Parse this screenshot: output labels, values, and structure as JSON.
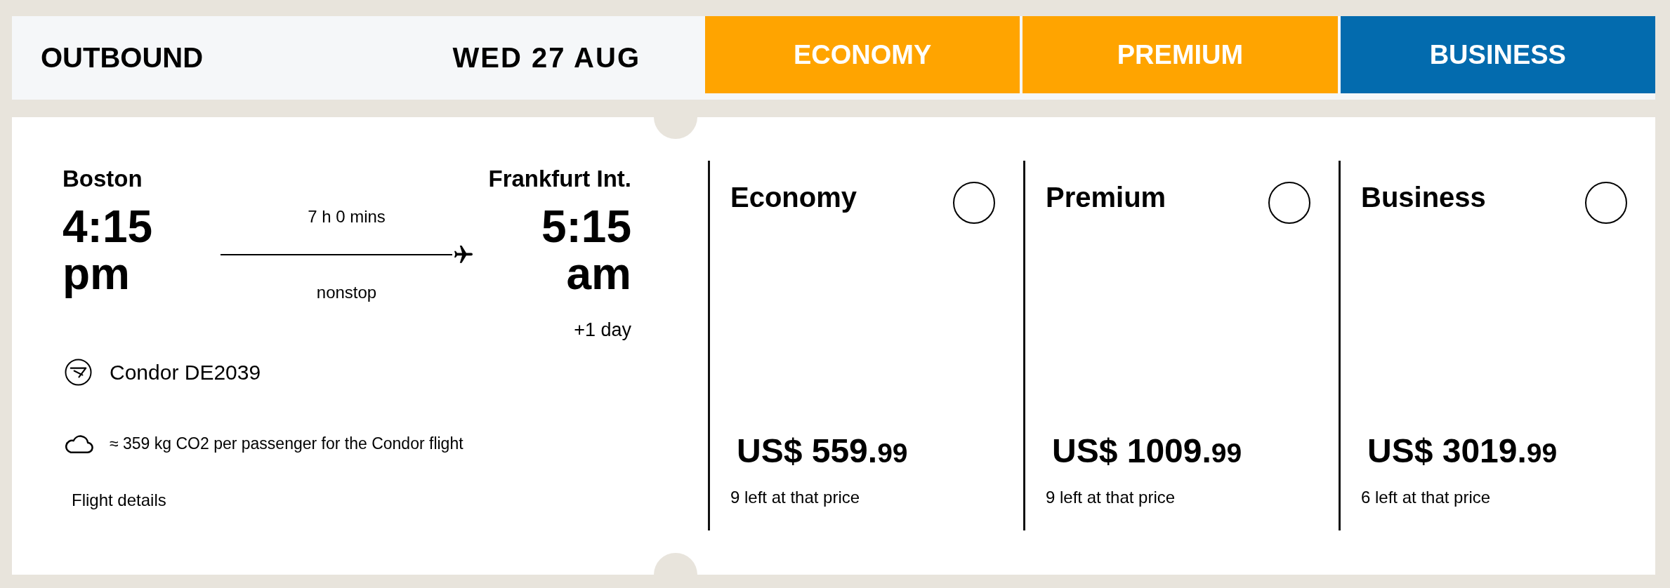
{
  "header": {
    "direction": "OUTBOUND",
    "date": "WED 27 AUG"
  },
  "cabins": [
    {
      "label": "ECONOMY",
      "color": "#ffa400"
    },
    {
      "label": "PREMIUM",
      "color": "#ffa400"
    },
    {
      "label": "BUSINESS",
      "color": "#036bae"
    }
  ],
  "flight": {
    "origin": {
      "city": "Boston",
      "time": "4:15 pm"
    },
    "destination": {
      "city": "Frankfurt Int.",
      "time": "5:15 am",
      "day_offset": "+1 day"
    },
    "duration": "7 h 0 mins",
    "stops": "nonstop",
    "carrier": "Condor DE2039",
    "emissions": "≈ 359 kg CO2 per passenger for the Condor flight",
    "details_link": "Flight details"
  },
  "fares": [
    {
      "name": "Economy",
      "selected": false,
      "price": "US$ 559.99",
      "availability": "9 left at that price"
    },
    {
      "name": "Premium",
      "selected": false,
      "price": "US$ 1009.99",
      "availability": "9 left at that price"
    },
    {
      "name": "Business",
      "selected": false,
      "price": "US$ 3019.99",
      "availability": "6 left at that price"
    }
  ]
}
